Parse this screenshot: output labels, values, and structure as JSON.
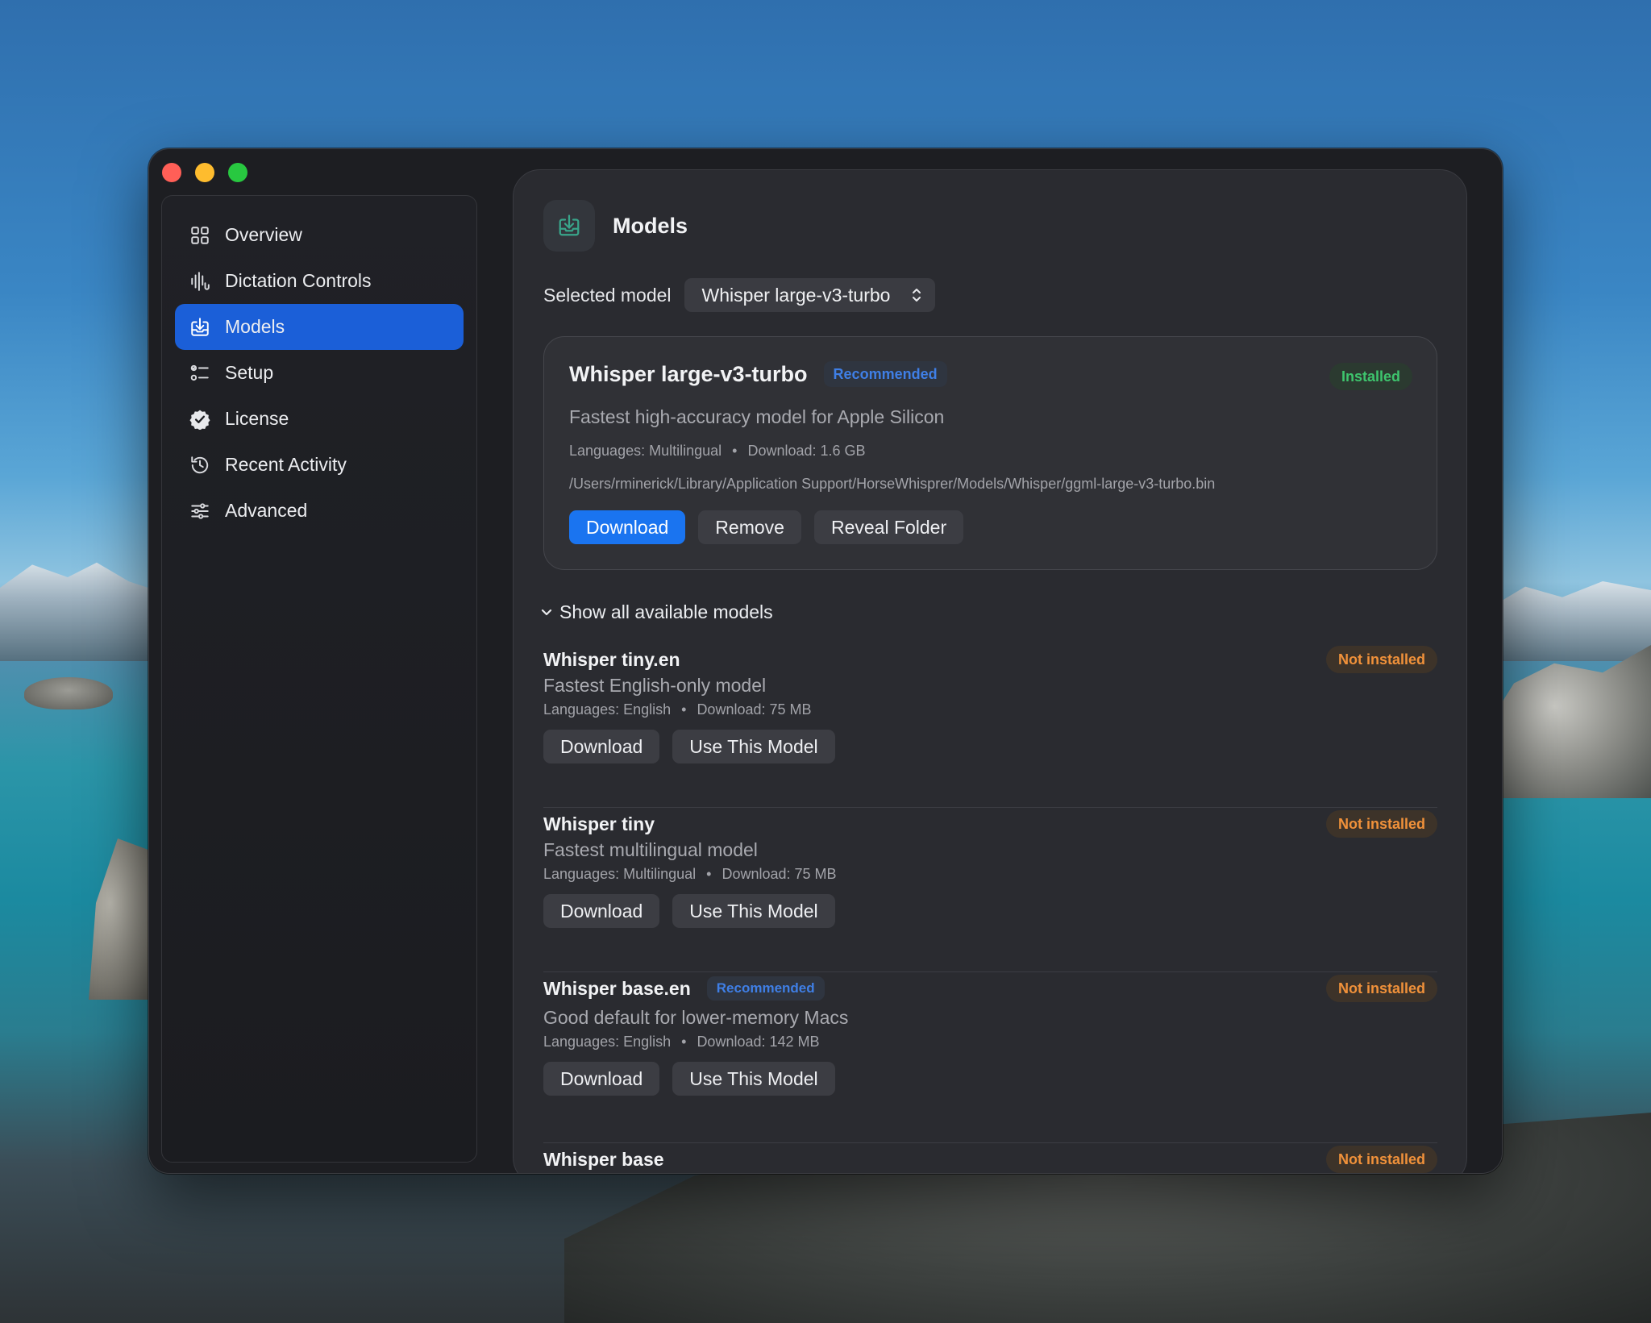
{
  "window": {
    "controls": [
      "close",
      "minimize",
      "maximize"
    ]
  },
  "sidebar": {
    "items": [
      {
        "label": "Overview",
        "icon": "grid-icon",
        "active": false
      },
      {
        "label": "Dictation Controls",
        "icon": "waveform-icon",
        "active": false
      },
      {
        "label": "Models",
        "icon": "download-tray-icon",
        "active": true
      },
      {
        "label": "Setup",
        "icon": "checklist-icon",
        "active": false
      },
      {
        "label": "License",
        "icon": "checkmark-seal-icon",
        "active": false
      },
      {
        "label": "Recent Activity",
        "icon": "clock-history-icon",
        "active": false
      },
      {
        "label": "Advanced",
        "icon": "sliders-icon",
        "active": false
      }
    ]
  },
  "header": {
    "title": "Models",
    "icon": "download-tray-icon"
  },
  "selected_model": {
    "label": "Selected model",
    "value": "Whisper large-v3-turbo"
  },
  "current_card": {
    "title": "Whisper large-v3-turbo",
    "badge": "Recommended",
    "status": "Installed",
    "description": "Fastest high-accuracy model for Apple Silicon",
    "languages": "Languages: Multilingual",
    "separator": "•",
    "download": "Download: 1.6 GB",
    "path": "/Users/rminerick/Library/Application Support/HorseWhisprer/Models/Whisper/ggml-large-v3-turbo.bin",
    "buttons": {
      "download": "Download",
      "remove": "Remove",
      "reveal": "Reveal Folder"
    }
  },
  "toggle_label": "Show all available models",
  "models": [
    {
      "name": "Whisper tiny.en",
      "badge": "",
      "status": "Not installed",
      "description": "Fastest English-only model",
      "languages": "Languages: English",
      "download": "Download: 75 MB",
      "download_btn": "Download",
      "use_btn": "Use This Model"
    },
    {
      "name": "Whisper tiny",
      "badge": "",
      "status": "Not installed",
      "description": "Fastest multilingual model",
      "languages": "Languages: Multilingual",
      "download": "Download: 75 MB",
      "download_btn": "Download",
      "use_btn": "Use This Model"
    },
    {
      "name": "Whisper base.en",
      "badge": "Recommended",
      "status": "Not installed",
      "description": "Good default for lower-memory Macs",
      "languages": "Languages: English",
      "download": "Download: 142 MB",
      "download_btn": "Download",
      "use_btn": "Use This Model"
    },
    {
      "name": "Whisper base",
      "badge": "",
      "status": "Not installed"
    }
  ],
  "colors": {
    "accent": "#1a74f0",
    "installed": "#3ec46d",
    "not_installed": "#f0913a",
    "recommended": "#3f7fe6"
  }
}
